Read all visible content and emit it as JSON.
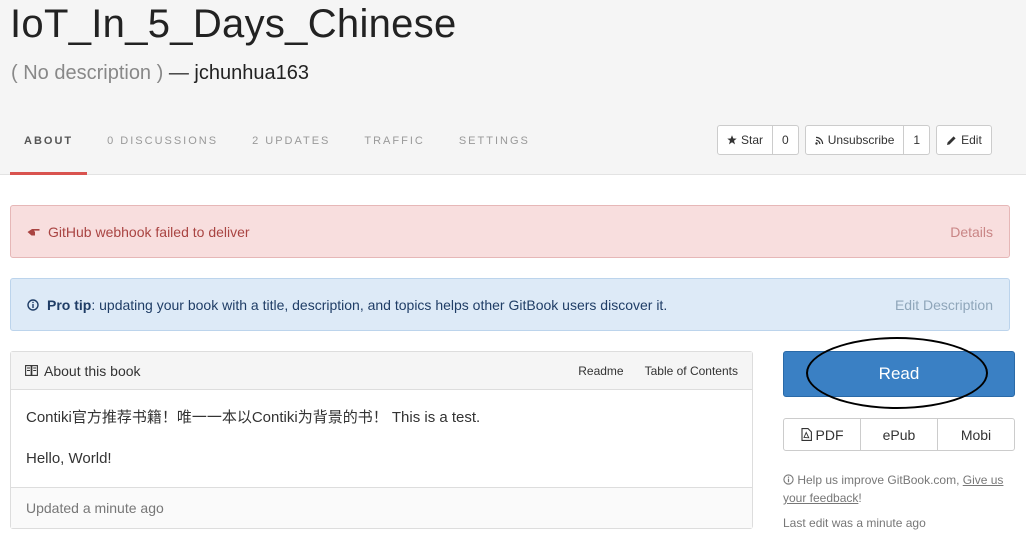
{
  "book": {
    "title": "IoT_In_5_Days_Chinese",
    "description": "( No description )",
    "dash": " — ",
    "author": "jchunhua163"
  },
  "tabs": [
    {
      "label": "ABOUT",
      "active": true
    },
    {
      "label": "0 DISCUSSIONS"
    },
    {
      "label": "2 UPDATES"
    },
    {
      "label": "TRAFFIC"
    },
    {
      "label": "SETTINGS"
    }
  ],
  "actions": {
    "star_label": "Star",
    "star_count": "0",
    "unsubscribe_label": "Unsubscribe",
    "unsubscribe_count": "1",
    "edit_label": "Edit"
  },
  "alerts": {
    "webhook_text": "GitHub webhook failed to deliver",
    "webhook_details": "Details",
    "protip_label": "Pro tip",
    "protip_text": ": updating your book with a title, description, and topics helps other GitBook users discover it.",
    "protip_link": "Edit Description"
  },
  "about_panel": {
    "title": "About this book",
    "readme_link": "Readme",
    "toc_link": "Table of Contents",
    "body_line1": "Contiki官方推荐书籍！唯一一本以Contiki为背景的书！ This is a test.",
    "body_line2": "Hello, World!",
    "updated": "Updated a minute ago"
  },
  "sidebar": {
    "read_label": "Read",
    "pdf_label": "PDF",
    "epub_label": "ePub",
    "mobi_label": "Mobi",
    "help_text": "Help us improve GitBook.com, ",
    "help_link": "Give us your feedback",
    "help_end": "!",
    "last_edit": "Last edit was a minute ago"
  },
  "colors": {
    "accent_tab": "#d9534f",
    "read_button": "#3a80c4",
    "danger_bg": "#f8dede",
    "info_bg": "#ddeaf7"
  }
}
